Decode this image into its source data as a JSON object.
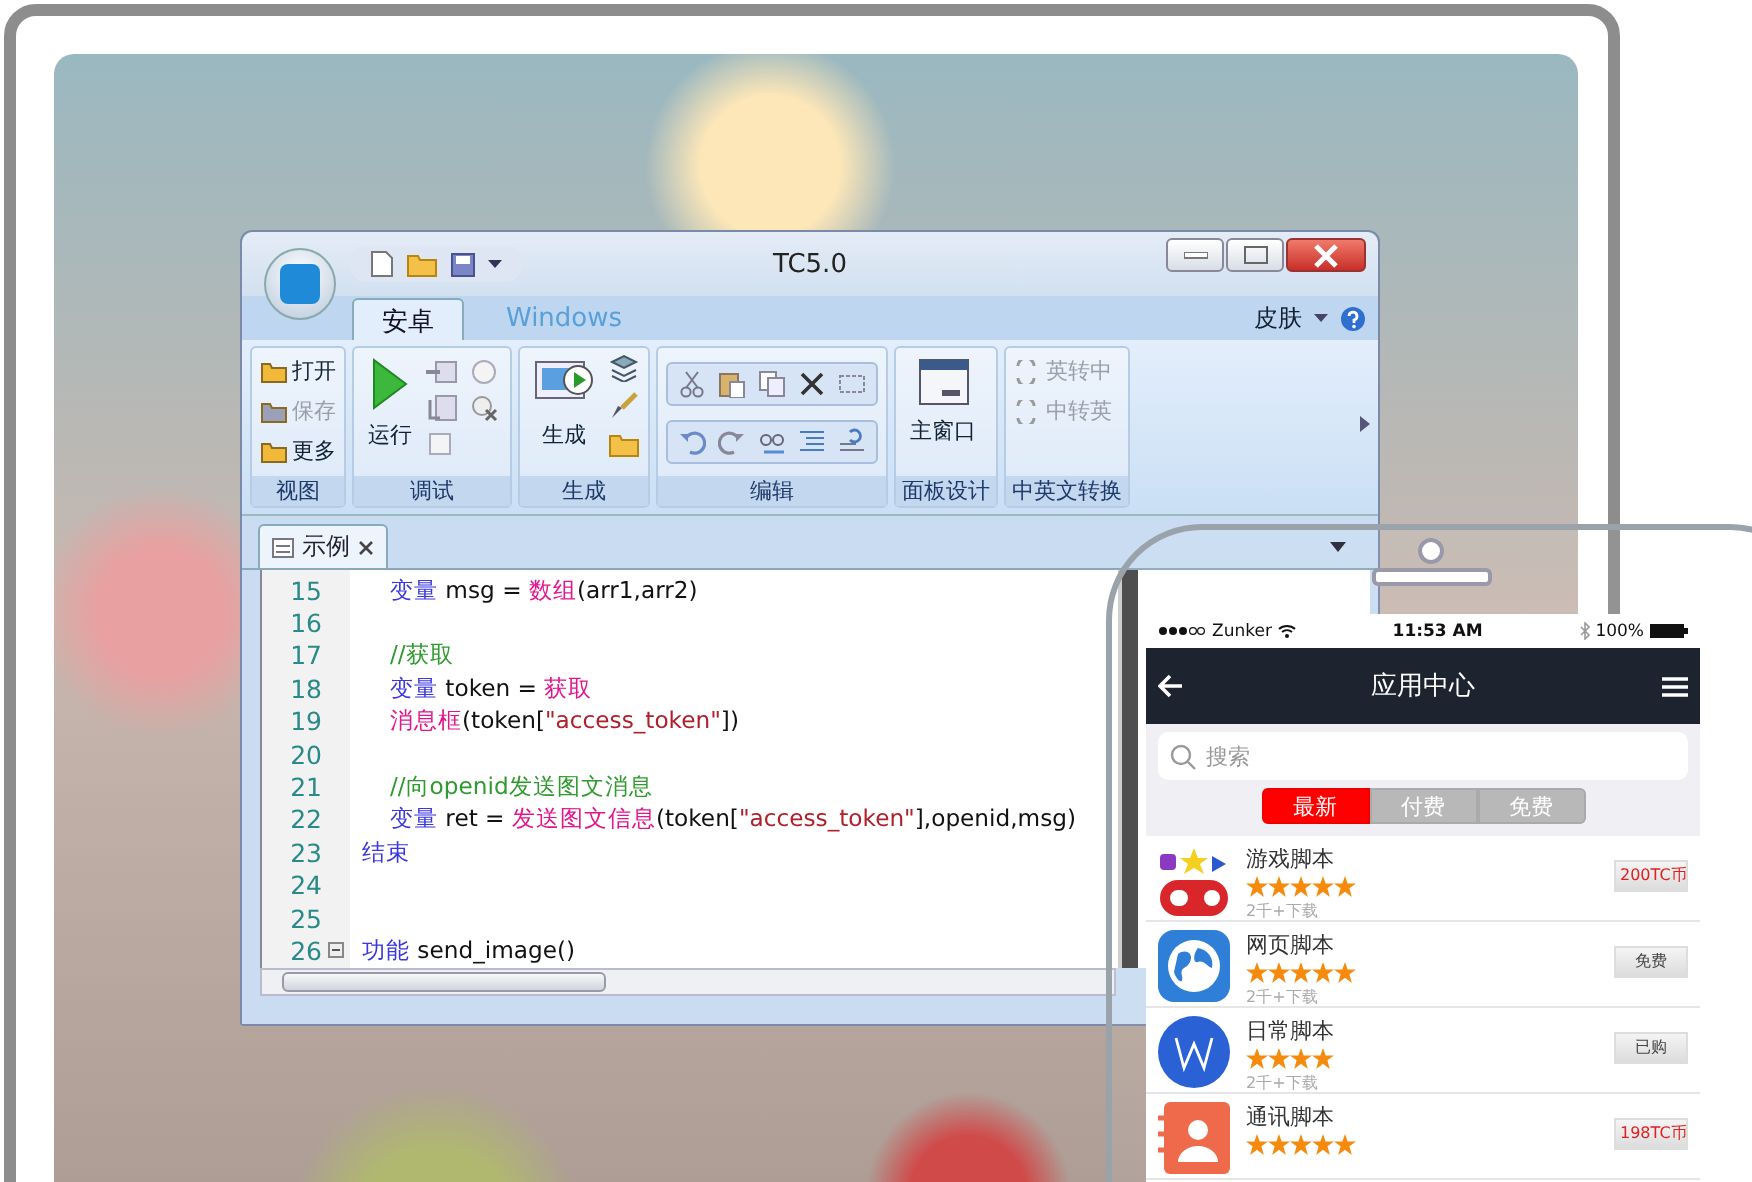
{
  "window": {
    "title": "TC5.0",
    "tabs": [
      {
        "label": "安卓",
        "selected": true
      },
      {
        "label": "Windows",
        "selected": false
      }
    ],
    "skin_menu": "皮肤"
  },
  "ribbon": {
    "groups": [
      {
        "kind": "list",
        "label": "视图",
        "items": [
          {
            "label": "打开",
            "disabled": false
          },
          {
            "label": "保存",
            "disabled": true
          },
          {
            "label": "更多",
            "disabled": false
          }
        ]
      },
      {
        "kind": "run",
        "label": "调试",
        "items": [
          {
            "label": "运行",
            "disabled": false
          }
        ]
      },
      {
        "kind": "build",
        "label": "生成",
        "items": [
          {
            "label": "生成",
            "disabled": false
          }
        ]
      },
      {
        "kind": "edit",
        "label": "编辑"
      },
      {
        "kind": "panel",
        "label": "面板设计",
        "items": [
          {
            "label": "主窗口",
            "disabled": false
          }
        ]
      },
      {
        "kind": "list",
        "label": "中英文转换",
        "items": [
          {
            "label": "英转中",
            "disabled": true
          },
          {
            "label": "中转英",
            "disabled": true
          }
        ]
      }
    ]
  },
  "document_tabs": [
    {
      "label": "示例",
      "selected": true
    }
  ],
  "code": [
    {
      "number": "15",
      "indented": true,
      "fold": false,
      "tokens": [
        {
          "kind": "keyword",
          "text": "变量"
        },
        {
          "kind": "plain",
          "text": " msg = "
        },
        {
          "kind": "function",
          "text": "数组"
        },
        {
          "kind": "plain",
          "text": "(arr1,arr2)"
        }
      ]
    },
    {
      "number": "16",
      "fold": false
    },
    {
      "number": "17",
      "indented": true,
      "fold": false,
      "tokens": [
        {
          "kind": "comment",
          "text": "//获取"
        }
      ]
    },
    {
      "number": "18",
      "indented": true,
      "fold": false,
      "tokens": [
        {
          "kind": "keyword",
          "text": "变量"
        },
        {
          "kind": "plain",
          "text": " token = "
        },
        {
          "kind": "function",
          "text": "获取"
        }
      ]
    },
    {
      "number": "19",
      "indented": true,
      "fold": false,
      "tokens": [
        {
          "kind": "function",
          "text": "消息框"
        },
        {
          "kind": "plain",
          "text": "(token["
        },
        {
          "kind": "string",
          "text": "\"access_token\""
        },
        {
          "kind": "plain",
          "text": "])"
        }
      ]
    },
    {
      "number": "20",
      "fold": false
    },
    {
      "number": "21",
      "indented": true,
      "fold": false,
      "tokens": [
        {
          "kind": "comment",
          "text": "//向openid发送图文消息"
        }
      ]
    },
    {
      "number": "22",
      "indented": true,
      "fold": false,
      "tokens": [
        {
          "kind": "keyword",
          "text": "变量"
        },
        {
          "kind": "plain",
          "text": " ret = "
        },
        {
          "kind": "function",
          "text": "发送图文信息"
        },
        {
          "kind": "plain",
          "text": "(token["
        },
        {
          "kind": "string",
          "text": "\"access_token\""
        },
        {
          "kind": "plain",
          "text": "],openid,msg)"
        }
      ]
    },
    {
      "number": "23",
      "indented": false,
      "fold": false,
      "tokens": [
        {
          "kind": "keyword",
          "text": "结束"
        }
      ]
    },
    {
      "number": "24",
      "fold": false
    },
    {
      "number": "25",
      "fold": false
    },
    {
      "number": "26",
      "indented": false,
      "fold": true,
      "tokens": [
        {
          "kind": "keyword",
          "text": "功能"
        },
        {
          "kind": "plain",
          "text": " send_image()"
        }
      ]
    }
  ],
  "phone": {
    "status_bar": {
      "carrier": "Zunker",
      "time": "11:53 AM",
      "battery": "100%"
    },
    "title": "应用中心",
    "search": {
      "placeholder": "搜索"
    },
    "segments": [
      {
        "label": "最新",
        "selected": true
      },
      {
        "label": "付费",
        "selected": false
      },
      {
        "label": "免费",
        "selected": false
      }
    ],
    "apps": [
      {
        "name": "游戏脚本",
        "stars": 5,
        "downloads": "2千+下载",
        "button": {
          "label": "200TC币",
          "kind": "paid"
        }
      },
      {
        "name": "网页脚本",
        "stars": 5,
        "downloads": "2千+下载",
        "button": {
          "label": "免费",
          "kind": "free"
        }
      },
      {
        "name": "日常脚本",
        "stars": 4,
        "downloads": "2千+下载",
        "button": {
          "label": "已购",
          "kind": "owned"
        }
      },
      {
        "name": "通讯脚本",
        "stars": 5,
        "button": {
          "label": "198TC币",
          "kind": "paid"
        }
      }
    ]
  }
}
